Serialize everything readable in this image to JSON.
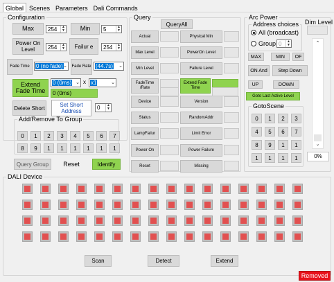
{
  "tabs": [
    "Global",
    "Scenes",
    "Parameters",
    "Dali Commands"
  ],
  "configuration": {
    "title": "Configuration",
    "max_label": "Max",
    "max_value": "254",
    "min_label": "Min",
    "min_value": "5",
    "power_on_label": "Power On Level",
    "power_on_value": "254",
    "failure_label": "Failur e",
    "failure_value": "254",
    "fade_time_label": "Fade Time",
    "fade_time_value": "0 (no fade)",
    "fade_rate_label": "Fade Rate",
    "fade_rate_value": "(44.7s)",
    "extend_fade_label": "Extend Fade Time",
    "extend_fade_value": "0 (0ms)",
    "multiplier_x": "x",
    "multiplier_value": "x1",
    "extend_readout": "0 (0ms)",
    "delete_short_label": "Delete Short",
    "set_short_label": "Set Short Address",
    "short_address_value": "0"
  },
  "add_remove": {
    "title": "Add/Remove To Group",
    "row1": [
      "0",
      "1",
      "2",
      "3",
      "4",
      "5",
      "6",
      "7"
    ],
    "row2": [
      "8",
      "9",
      "1",
      "1",
      "1",
      "1",
      "1",
      "1"
    ]
  },
  "bottom_left": {
    "query_group": "Query Group",
    "reset": "Reset",
    "identify": "Identify"
  },
  "query": {
    "title": "Query",
    "query_all": "QueryAll",
    "left_buttons": [
      "Actual",
      "Max Level",
      "Min Level",
      "FadeTime /Rate",
      "Device",
      "Status",
      "LampFailur",
      "Power On",
      "Reset"
    ],
    "right_buttons": [
      "Physical Min",
      "PowerOn Level",
      "Failure Level",
      "Extend Fade Time",
      "Version",
      "RandomAddr",
      "Limit Error",
      "Power Failure",
      "Missing"
    ]
  },
  "arc_power": {
    "title": "Arc Power",
    "address_choices_title": "Address choices",
    "all_broadcast": "All (broadcast)",
    "group_label": "Group",
    "group_value": "0",
    "max": "MAX",
    "min": "MIN",
    "off": "OF",
    "on_and": "ON And",
    "step_down": "Step Down",
    "up": "UP",
    "down": "DOWN",
    "goto_last": "Goto Last Active Level",
    "dim_level_label": "Dim Level",
    "dim_percent": "0%",
    "dim_level_fraction": 0
  },
  "goto_scene": {
    "title": "GotoScene",
    "rows": [
      [
        "0",
        "1",
        "2",
        "3"
      ],
      [
        "4",
        "5",
        "6",
        "7"
      ],
      [
        "8",
        "9",
        "1",
        "1"
      ],
      [
        "1",
        "1",
        "1",
        "1"
      ]
    ]
  },
  "dali_device": {
    "title": "DALI Device",
    "rows": 4,
    "cols": 16,
    "scan": "Scan",
    "detect": "Detect",
    "extend": "Extend"
  },
  "status": {
    "removed": "Removed"
  },
  "colors": {
    "accent_green": "#8fd34f",
    "device_red": "#e25050",
    "removed_red": "#e8121c",
    "selection_blue": "#0078d7"
  }
}
